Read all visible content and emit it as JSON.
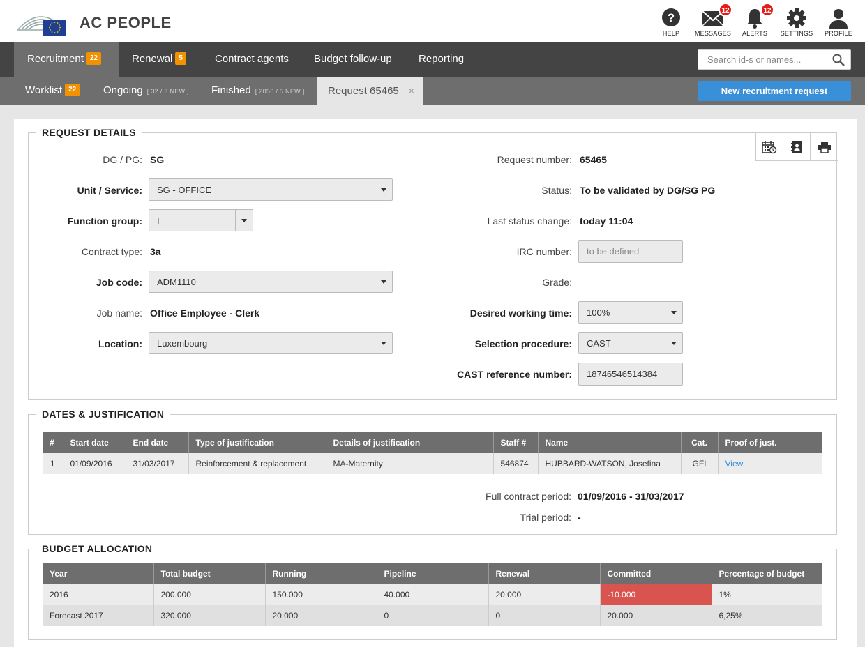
{
  "header": {
    "app_title": "AC PEOPLE",
    "icons": [
      {
        "name": "help-icon",
        "label": "HELP"
      },
      {
        "name": "messages-icon",
        "label": "MESSAGES",
        "badge": "12"
      },
      {
        "name": "alerts-icon",
        "label": "ALERTS",
        "badge": "12"
      },
      {
        "name": "settings-icon",
        "label": "SETTINGS"
      },
      {
        "name": "profile-icon",
        "label": "PROFILE"
      }
    ]
  },
  "main_nav": {
    "items": [
      {
        "label": "Recruitment",
        "badge": "22",
        "active": true
      },
      {
        "label": "Renewal",
        "badge": "5"
      },
      {
        "label": "Contract agents"
      },
      {
        "label": "Budget follow-up"
      },
      {
        "label": "Reporting"
      }
    ],
    "search_placeholder": "Search id-s or names..."
  },
  "sub_nav": {
    "items": [
      {
        "label": "Worklist",
        "badge": "22"
      },
      {
        "label": "Ongoing",
        "meta": "[ 32 / 3 NEW ]"
      },
      {
        "label": "Finished",
        "meta": "[ 2056 / 5 NEW ]"
      },
      {
        "label": "Request 65465",
        "active": true,
        "close": "×"
      }
    ],
    "new_button": "New recruitment request"
  },
  "request_details": {
    "title": "REQUEST DETAILS",
    "left": {
      "dg_pg_label": "DG / PG:",
      "dg_pg_value": "SG",
      "unit_label": "Unit / Service:",
      "unit_value": "SG - OFFICE",
      "function_group_label": "Function group:",
      "function_group_value": "I",
      "contract_type_label": "Contract type:",
      "contract_type_value": "3a",
      "job_code_label": "Job code:",
      "job_code_value": "ADM1110",
      "job_name_label": "Job name:",
      "job_name_value": "Office Employee - Clerk",
      "location_label": "Location:",
      "location_value": "Luxembourg"
    },
    "right": {
      "request_number_label": "Request number:",
      "request_number_value": "65465",
      "status_label": "Status:",
      "status_value": "To be validated by DG/SG PG",
      "last_status_label": "Last status change:",
      "last_status_value": "today 11:04",
      "irc_label": "IRC number:",
      "irc_placeholder": "to be defined",
      "grade_label": "Grade:",
      "working_time_label": "Desired working time:",
      "working_time_value": "100%",
      "selection_label": "Selection procedure:",
      "selection_value": "CAST",
      "cast_ref_label": "CAST reference number:",
      "cast_ref_value": "18746546514384"
    }
  },
  "dates": {
    "title": "DATES & JUSTIFICATION",
    "columns": [
      "#",
      "Start date",
      "End date",
      "Type of justification",
      "Details of justification",
      "Staff #",
      "Name",
      "Cat.",
      "Proof of just."
    ],
    "rows": [
      [
        "1",
        "01/09/2016",
        "31/03/2017",
        "Reinforcement & replacement",
        "MA-Maternity",
        "546874",
        "HUBBARD-WATSON, Josefina",
        "GFI",
        "View"
      ]
    ],
    "full_period_label": "Full contract period:",
    "full_period_value": "01/09/2016 - 31/03/2017",
    "trial_label": "Trial period:",
    "trial_value": "-"
  },
  "budget": {
    "title": "BUDGET ALLOCATION",
    "columns": [
      "Year",
      "Total budget",
      "Running",
      "Pipeline",
      "Renewal",
      "Committed",
      "Percentage of budget"
    ],
    "rows": [
      [
        "2016",
        "200.000",
        "150.000",
        "40.000",
        "20.000",
        "-10.000",
        "1%"
      ],
      [
        "Forecast 2017",
        "320.000",
        "20.000",
        "0",
        "0",
        "20.000",
        "6,25%"
      ]
    ]
  },
  "colors": {
    "accent": "#3a8fd9",
    "badge_orange": "#f39200",
    "badge_red": "#e41b17",
    "negative": "#d9534f",
    "nav_dark": "#444444",
    "nav_mid": "#6e6e6e"
  }
}
